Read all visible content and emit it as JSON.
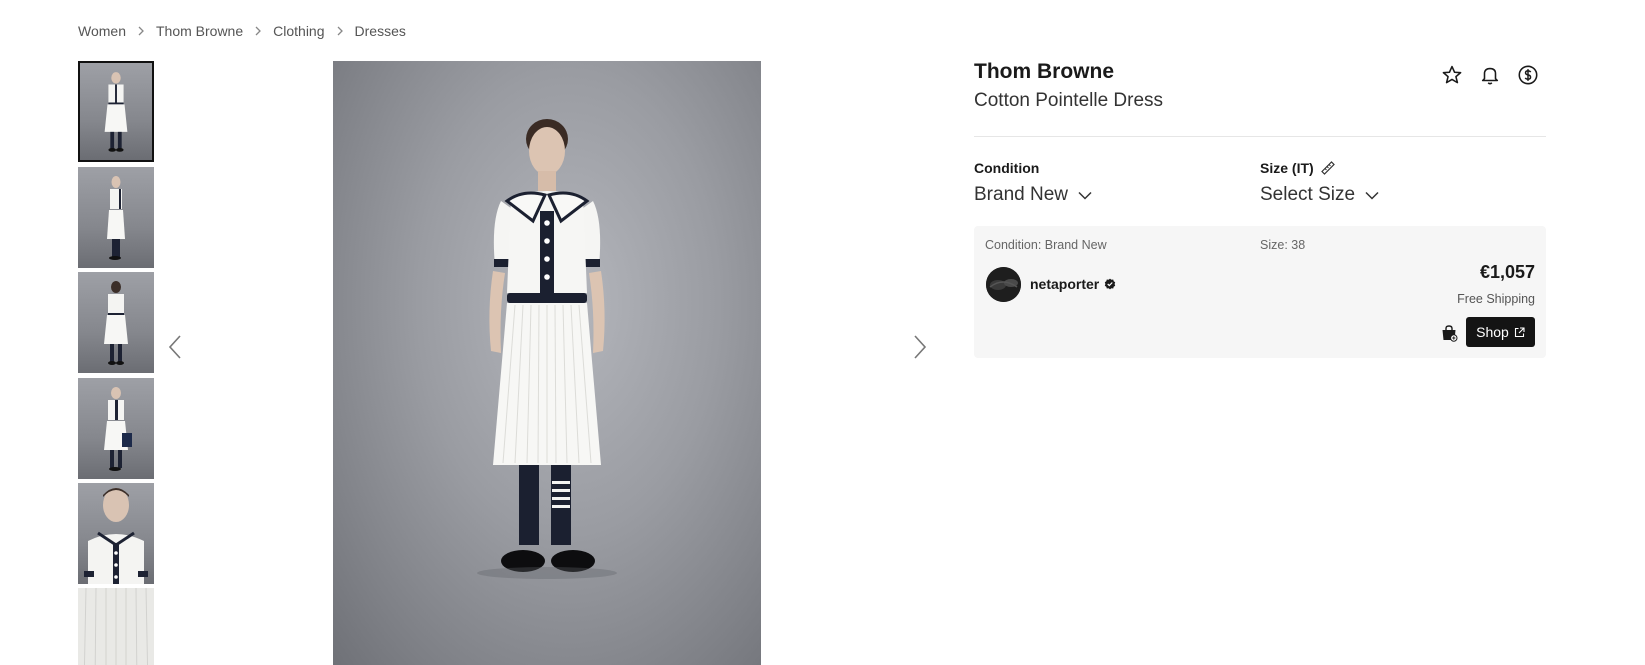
{
  "breadcrumb": {
    "items": [
      "Women",
      "Thom Browne",
      "Clothing",
      "Dresses"
    ]
  },
  "gallery": {
    "thumbnail_count_visible": 6,
    "selected_index": 0
  },
  "product": {
    "brand": "Thom Browne",
    "name": "Cotton Pointelle Dress"
  },
  "header_icons": [
    "star-icon",
    "bell-icon",
    "dollar-circle-icon"
  ],
  "options": {
    "condition": {
      "label": "Condition",
      "value": "Brand New"
    },
    "size": {
      "label": "Size (IT)",
      "value": "Select Size"
    }
  },
  "offer": {
    "condition_text": "Condition: Brand New",
    "size_text": "Size: 38",
    "seller": "netaporter",
    "price": "€1,057",
    "shipping": "Free Shipping",
    "shop_label": "Shop"
  },
  "colors": {
    "accent": "#141414",
    "card_bg": "#f6f6f6",
    "text_muted": "#666666"
  }
}
